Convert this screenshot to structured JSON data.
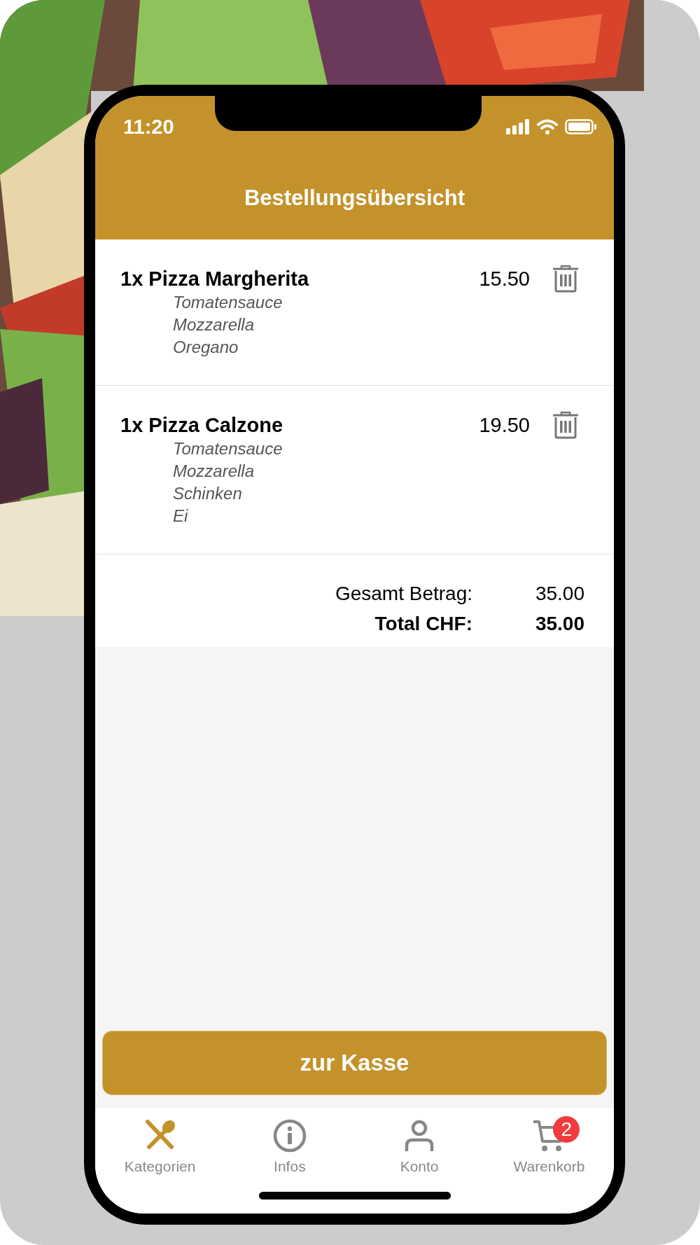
{
  "status_bar": {
    "time": "11:20"
  },
  "header": {
    "title": "Bestellungsübersicht"
  },
  "order_items": [
    {
      "name": "1x Pizza Margherita",
      "price": "15.50",
      "ingredients": [
        "Tomatensauce",
        "Mozzarella",
        "Oregano"
      ]
    },
    {
      "name": "1x Pizza Calzone",
      "price": "19.50",
      "ingredients": [
        "Tomatensauce",
        "Mozzarella",
        "Schinken",
        "Ei"
      ]
    }
  ],
  "totals": [
    {
      "kind": "subtotal",
      "label": "Gesamt Betrag:",
      "value": "35.00"
    },
    {
      "kind": "total",
      "label": "Total CHF:",
      "value": "35.00"
    }
  ],
  "checkout_button": {
    "label": "zur Kasse"
  },
  "tab_bar": [
    {
      "kind": "utensils",
      "label": "Kategorien",
      "selected": true
    },
    {
      "kind": "info",
      "label": "Infos",
      "selected": false
    },
    {
      "kind": "person",
      "label": "Konto",
      "selected": false
    },
    {
      "kind": "cart",
      "label": "Warenkorb",
      "selected": false,
      "badge": "2"
    }
  ]
}
